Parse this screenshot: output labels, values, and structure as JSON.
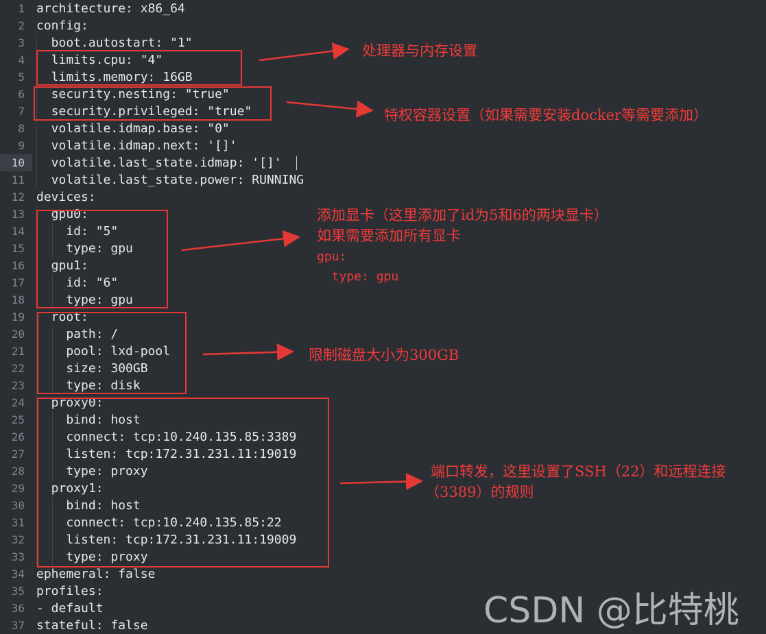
{
  "editor": {
    "current_line": 10,
    "lines": [
      {
        "n": "1",
        "t": "architecture: x86_64"
      },
      {
        "n": "2",
        "t": "config:"
      },
      {
        "n": "3",
        "t": "  boot.autostart: \"1\""
      },
      {
        "n": "4",
        "t": "  limits.cpu: \"4\""
      },
      {
        "n": "5",
        "t": "  limits.memory: 16GB"
      },
      {
        "n": "6",
        "t": "  security.nesting: \"true\""
      },
      {
        "n": "7",
        "t": "  security.privileged: \"true\""
      },
      {
        "n": "8",
        "t": "  volatile.idmap.base: \"0\""
      },
      {
        "n": "9",
        "t": "  volatile.idmap.next: '[]'"
      },
      {
        "n": "10",
        "t": "  volatile.last_state.idmap: '[]'"
      },
      {
        "n": "11",
        "t": "  volatile.last_state.power: RUNNING"
      },
      {
        "n": "12",
        "t": "devices:"
      },
      {
        "n": "13",
        "t": "  gpu0:"
      },
      {
        "n": "14",
        "t": "    id: \"5\""
      },
      {
        "n": "15",
        "t": "    type: gpu"
      },
      {
        "n": "16",
        "t": "  gpu1:"
      },
      {
        "n": "17",
        "t": "    id: \"6\""
      },
      {
        "n": "18",
        "t": "    type: gpu"
      },
      {
        "n": "19",
        "t": "  root:"
      },
      {
        "n": "20",
        "t": "    path: /"
      },
      {
        "n": "21",
        "t": "    pool: lxd-pool"
      },
      {
        "n": "22",
        "t": "    size: 300GB"
      },
      {
        "n": "23",
        "t": "    type: disk"
      },
      {
        "n": "24",
        "t": "  proxy0:"
      },
      {
        "n": "25",
        "t": "    bind: host"
      },
      {
        "n": "26",
        "t": "    connect: tcp:10.240.135.85:3389"
      },
      {
        "n": "27",
        "t": "    listen: tcp:172.31.231.11:19019"
      },
      {
        "n": "28",
        "t": "    type: proxy"
      },
      {
        "n": "29",
        "t": "  proxy1:"
      },
      {
        "n": "30",
        "t": "    bind: host"
      },
      {
        "n": "31",
        "t": "    connect: tcp:10.240.135.85:22"
      },
      {
        "n": "32",
        "t": "    listen: tcp:172.31.231.11:19009"
      },
      {
        "n": "33",
        "t": "    type: proxy"
      },
      {
        "n": "34",
        "t": "ephemeral: false"
      },
      {
        "n": "35",
        "t": "profiles:"
      },
      {
        "n": "36",
        "t": "- default"
      },
      {
        "n": "37",
        "t": "stateful: false"
      }
    ]
  },
  "annotations": {
    "cpu_mem": "处理器与内存设置",
    "privileged": "特权容器设置（如果需要安装docker等需要添加）",
    "gpu_line1": "添加显卡（这里添加了id为5和6的两块显卡）",
    "gpu_line2": "如果需要添加所有显卡",
    "gpu_code1": "gpu:",
    "gpu_code2": "  type: gpu",
    "disk": "限制磁盘大小为300GB",
    "proxy_line1": "端口转发，这里设置了SSH（22）和远程连接",
    "proxy_line2": "（3389）的规则"
  },
  "watermark": "CSDN @比特桃",
  "colors": {
    "background": "#2b2f33",
    "annotation": "#f03a3a",
    "box": "#e53935",
    "line_number": "#7d8590",
    "code_text": "#e8e8e8"
  }
}
